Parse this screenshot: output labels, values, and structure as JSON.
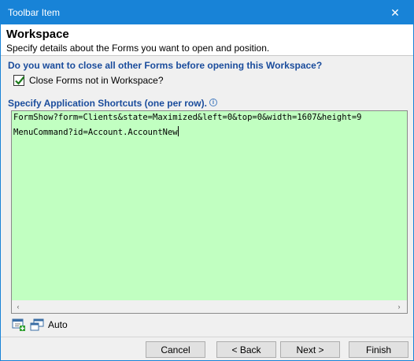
{
  "window": {
    "title": "Toolbar Item",
    "close_glyph": "✕",
    "accent_color": "#1883d7"
  },
  "header": {
    "title": "Workspace",
    "subtitle": "Specify details about the Forms you want to open and position."
  },
  "close_forms": {
    "question": "Do you want to close all other Forms before opening this Workspace?",
    "checkbox_label": "Close Forms not in Workspace?",
    "checked": true
  },
  "shortcuts": {
    "label": "Specify Application Shortcuts (one per row).",
    "info_glyph": "i",
    "editor_background": "#c1ffc1",
    "lines": [
      "FormShow?form=Clients&state=Maximized&left=0&top=0&width=1607&height=9",
      "MenuCommand?id=Account.AccountNew"
    ],
    "scroll_left_glyph": "‹",
    "scroll_right_glyph": "›"
  },
  "toolbar": {
    "icons": [
      "add-form-icon",
      "windows-layout-icon"
    ],
    "auto_label": "Auto"
  },
  "buttons": {
    "cancel": "Cancel",
    "back": "< Back",
    "next": "Next >",
    "finish": "Finish"
  }
}
